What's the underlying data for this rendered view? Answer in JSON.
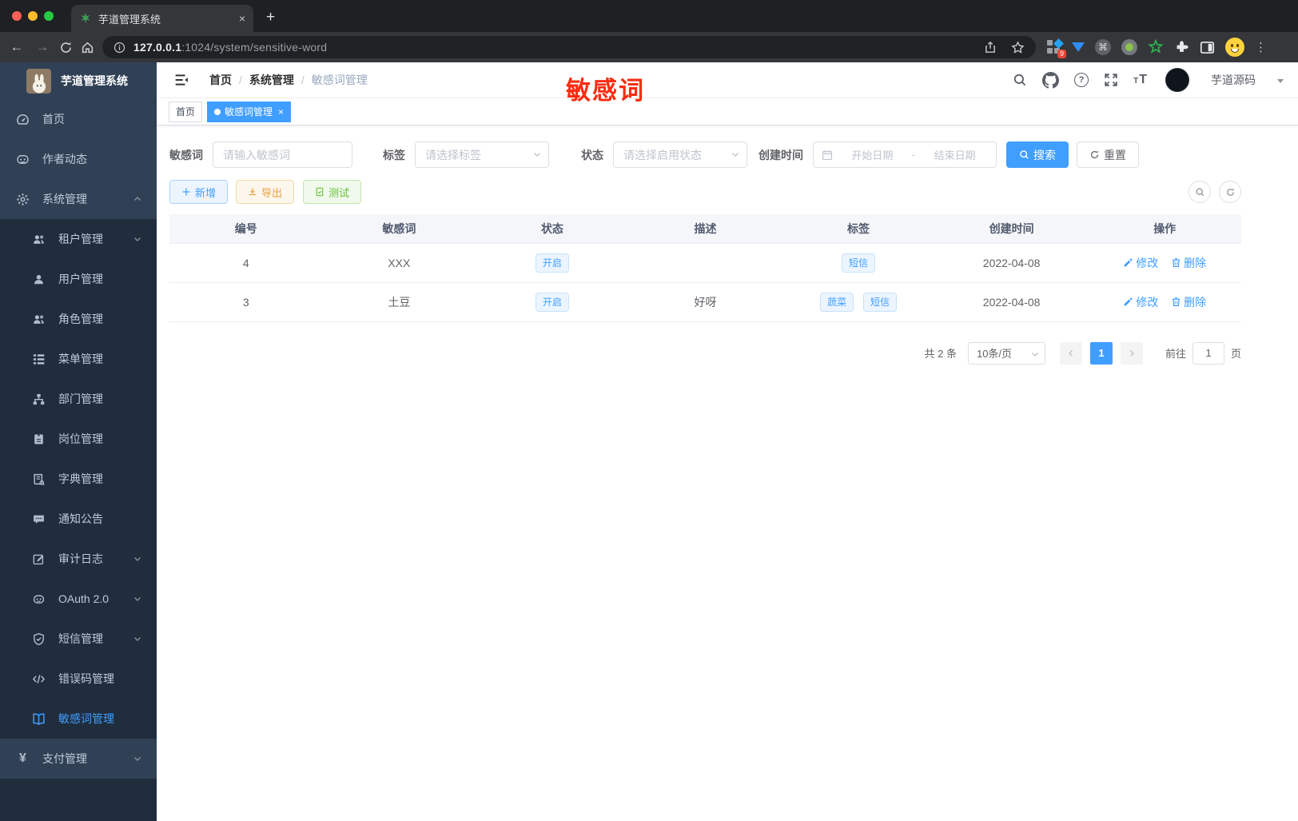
{
  "colors": {
    "accent": "#409eff",
    "sidebar_bg": "#304156",
    "submenu_bg": "#1f2d3d",
    "warning": "#e6a23c",
    "success": "#67c23a",
    "overlay_red": "#fb2c10"
  },
  "icons": {
    "back": "←",
    "forward": "→",
    "close": "×",
    "newtab": "+",
    "kebab": "⋮",
    "cmd": "⌘",
    "help": "?",
    "yen": "¥",
    "tab_dot": "●",
    "font_small": "T",
    "font_big": "T",
    "date_sep": "-",
    "crumb_sep": "/"
  },
  "browser": {
    "tab_title": "芋道管理系统",
    "url_host": "127.0.0.1",
    "url_rest": ":1024/system/sensitive-word",
    "extension_badge": "9"
  },
  "overlay": {
    "text": "敏感词"
  },
  "sidebar": {
    "title": "芋道管理系统",
    "items": [
      {
        "icon": "dashboard-icon",
        "label": "首页"
      },
      {
        "icon": "author-icon",
        "label": "作者动态"
      },
      {
        "icon": "gear-icon",
        "label": "系统管理"
      },
      {
        "icon": "tenant-icon",
        "label": "租户管理"
      },
      {
        "icon": "user-icon",
        "label": "用户管理"
      },
      {
        "icon": "role-icon",
        "label": "角色管理"
      },
      {
        "icon": "menu-icon",
        "label": "菜单管理"
      },
      {
        "icon": "dept-icon",
        "label": "部门管理"
      },
      {
        "icon": "post-icon",
        "label": "岗位管理"
      },
      {
        "icon": "dict-icon",
        "label": "字典管理"
      },
      {
        "icon": "notice-icon",
        "label": "通知公告"
      },
      {
        "icon": "audit-icon",
        "label": "审计日志"
      },
      {
        "icon": "oauth-icon",
        "label": "OAuth 2.0"
      },
      {
        "icon": "sms-icon",
        "label": "短信管理"
      },
      {
        "icon": "errcode-icon",
        "label": "错误码管理"
      },
      {
        "icon": "openbook-icon",
        "label": "敏感词管理"
      },
      {
        "icon": "pay-icon",
        "label": "支付管理"
      }
    ]
  },
  "header": {
    "breadcrumb": [
      "首页",
      "系统管理",
      "敏感词管理"
    ],
    "user_name": "芋道源码"
  },
  "tags_bar": {
    "tabs": [
      {
        "label": "首页"
      },
      {
        "label": "敏感词管理"
      }
    ]
  },
  "filters": {
    "keyword_label": "敏感词",
    "keyword_placeholder": "请输入敏感词",
    "tag_label": "标签",
    "tag_placeholder": "请选择标签",
    "status_label": "状态",
    "status_placeholder": "请选择启用状态",
    "date_label": "创建时间",
    "date_start": "开始日期",
    "date_end": "结束日期",
    "search_label": "搜索",
    "reset_label": "重置"
  },
  "toolbar": {
    "add_label": "新增",
    "export_label": "导出",
    "test_label": "测试"
  },
  "table": {
    "columns": [
      "编号",
      "敏感词",
      "状态",
      "描述",
      "标签",
      "创建时间",
      "操作"
    ],
    "edit_label": "修改",
    "delete_label": "删除",
    "rows": [
      {
        "id": "4",
        "word": "XXX",
        "status": "开启",
        "desc": "",
        "tags": [
          "短信"
        ],
        "created": "2022-04-08"
      },
      {
        "id": "3",
        "word": "土豆",
        "status": "开启",
        "desc": "好呀",
        "tags": [
          "蔬菜",
          "短信"
        ],
        "created": "2022-04-08"
      }
    ]
  },
  "pagination": {
    "total": "共 2 条",
    "page_size": "10条/页",
    "current_page": "1",
    "goto_prefix": "前往",
    "goto_value": "1",
    "goto_suffix": "页"
  }
}
